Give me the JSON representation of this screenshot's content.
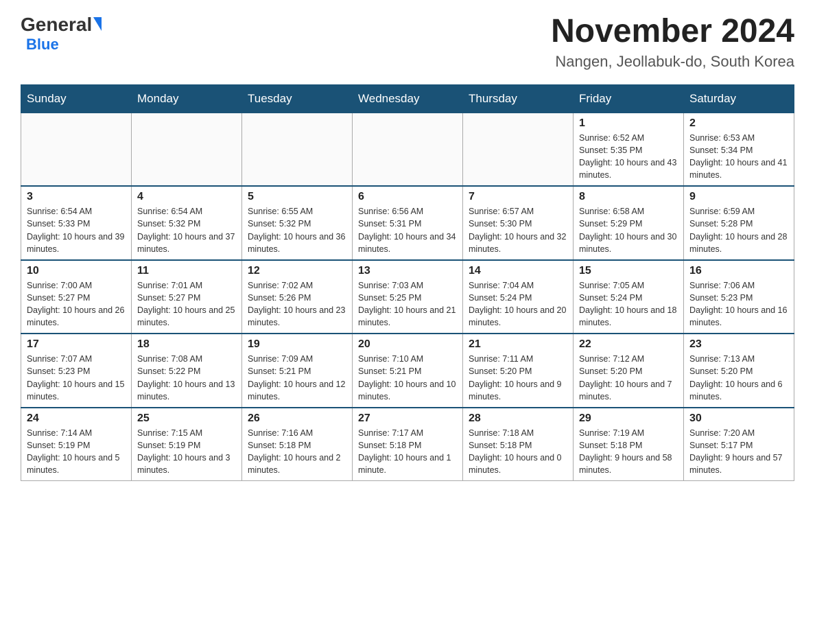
{
  "header": {
    "logo_general": "General",
    "logo_blue": "Blue",
    "month_title": "November 2024",
    "location": "Nangen, Jeollabuk-do, South Korea"
  },
  "weekdays": [
    "Sunday",
    "Monday",
    "Tuesday",
    "Wednesday",
    "Thursday",
    "Friday",
    "Saturday"
  ],
  "weeks": [
    [
      null,
      null,
      null,
      null,
      null,
      {
        "day": "1",
        "sunrise": "Sunrise: 6:52 AM",
        "sunset": "Sunset: 5:35 PM",
        "daylight": "Daylight: 10 hours and 43 minutes."
      },
      {
        "day": "2",
        "sunrise": "Sunrise: 6:53 AM",
        "sunset": "Sunset: 5:34 PM",
        "daylight": "Daylight: 10 hours and 41 minutes."
      }
    ],
    [
      {
        "day": "3",
        "sunrise": "Sunrise: 6:54 AM",
        "sunset": "Sunset: 5:33 PM",
        "daylight": "Daylight: 10 hours and 39 minutes."
      },
      {
        "day": "4",
        "sunrise": "Sunrise: 6:54 AM",
        "sunset": "Sunset: 5:32 PM",
        "daylight": "Daylight: 10 hours and 37 minutes."
      },
      {
        "day": "5",
        "sunrise": "Sunrise: 6:55 AM",
        "sunset": "Sunset: 5:32 PM",
        "daylight": "Daylight: 10 hours and 36 minutes."
      },
      {
        "day": "6",
        "sunrise": "Sunrise: 6:56 AM",
        "sunset": "Sunset: 5:31 PM",
        "daylight": "Daylight: 10 hours and 34 minutes."
      },
      {
        "day": "7",
        "sunrise": "Sunrise: 6:57 AM",
        "sunset": "Sunset: 5:30 PM",
        "daylight": "Daylight: 10 hours and 32 minutes."
      },
      {
        "day": "8",
        "sunrise": "Sunrise: 6:58 AM",
        "sunset": "Sunset: 5:29 PM",
        "daylight": "Daylight: 10 hours and 30 minutes."
      },
      {
        "day": "9",
        "sunrise": "Sunrise: 6:59 AM",
        "sunset": "Sunset: 5:28 PM",
        "daylight": "Daylight: 10 hours and 28 minutes."
      }
    ],
    [
      {
        "day": "10",
        "sunrise": "Sunrise: 7:00 AM",
        "sunset": "Sunset: 5:27 PM",
        "daylight": "Daylight: 10 hours and 26 minutes."
      },
      {
        "day": "11",
        "sunrise": "Sunrise: 7:01 AM",
        "sunset": "Sunset: 5:27 PM",
        "daylight": "Daylight: 10 hours and 25 minutes."
      },
      {
        "day": "12",
        "sunrise": "Sunrise: 7:02 AM",
        "sunset": "Sunset: 5:26 PM",
        "daylight": "Daylight: 10 hours and 23 minutes."
      },
      {
        "day": "13",
        "sunrise": "Sunrise: 7:03 AM",
        "sunset": "Sunset: 5:25 PM",
        "daylight": "Daylight: 10 hours and 21 minutes."
      },
      {
        "day": "14",
        "sunrise": "Sunrise: 7:04 AM",
        "sunset": "Sunset: 5:24 PM",
        "daylight": "Daylight: 10 hours and 20 minutes."
      },
      {
        "day": "15",
        "sunrise": "Sunrise: 7:05 AM",
        "sunset": "Sunset: 5:24 PM",
        "daylight": "Daylight: 10 hours and 18 minutes."
      },
      {
        "day": "16",
        "sunrise": "Sunrise: 7:06 AM",
        "sunset": "Sunset: 5:23 PM",
        "daylight": "Daylight: 10 hours and 16 minutes."
      }
    ],
    [
      {
        "day": "17",
        "sunrise": "Sunrise: 7:07 AM",
        "sunset": "Sunset: 5:23 PM",
        "daylight": "Daylight: 10 hours and 15 minutes."
      },
      {
        "day": "18",
        "sunrise": "Sunrise: 7:08 AM",
        "sunset": "Sunset: 5:22 PM",
        "daylight": "Daylight: 10 hours and 13 minutes."
      },
      {
        "day": "19",
        "sunrise": "Sunrise: 7:09 AM",
        "sunset": "Sunset: 5:21 PM",
        "daylight": "Daylight: 10 hours and 12 minutes."
      },
      {
        "day": "20",
        "sunrise": "Sunrise: 7:10 AM",
        "sunset": "Sunset: 5:21 PM",
        "daylight": "Daylight: 10 hours and 10 minutes."
      },
      {
        "day": "21",
        "sunrise": "Sunrise: 7:11 AM",
        "sunset": "Sunset: 5:20 PM",
        "daylight": "Daylight: 10 hours and 9 minutes."
      },
      {
        "day": "22",
        "sunrise": "Sunrise: 7:12 AM",
        "sunset": "Sunset: 5:20 PM",
        "daylight": "Daylight: 10 hours and 7 minutes."
      },
      {
        "day": "23",
        "sunrise": "Sunrise: 7:13 AM",
        "sunset": "Sunset: 5:20 PM",
        "daylight": "Daylight: 10 hours and 6 minutes."
      }
    ],
    [
      {
        "day": "24",
        "sunrise": "Sunrise: 7:14 AM",
        "sunset": "Sunset: 5:19 PM",
        "daylight": "Daylight: 10 hours and 5 minutes."
      },
      {
        "day": "25",
        "sunrise": "Sunrise: 7:15 AM",
        "sunset": "Sunset: 5:19 PM",
        "daylight": "Daylight: 10 hours and 3 minutes."
      },
      {
        "day": "26",
        "sunrise": "Sunrise: 7:16 AM",
        "sunset": "Sunset: 5:18 PM",
        "daylight": "Daylight: 10 hours and 2 minutes."
      },
      {
        "day": "27",
        "sunrise": "Sunrise: 7:17 AM",
        "sunset": "Sunset: 5:18 PM",
        "daylight": "Daylight: 10 hours and 1 minute."
      },
      {
        "day": "28",
        "sunrise": "Sunrise: 7:18 AM",
        "sunset": "Sunset: 5:18 PM",
        "daylight": "Daylight: 10 hours and 0 minutes."
      },
      {
        "day": "29",
        "sunrise": "Sunrise: 7:19 AM",
        "sunset": "Sunset: 5:18 PM",
        "daylight": "Daylight: 9 hours and 58 minutes."
      },
      {
        "day": "30",
        "sunrise": "Sunrise: 7:20 AM",
        "sunset": "Sunset: 5:17 PM",
        "daylight": "Daylight: 9 hours and 57 minutes."
      }
    ]
  ]
}
